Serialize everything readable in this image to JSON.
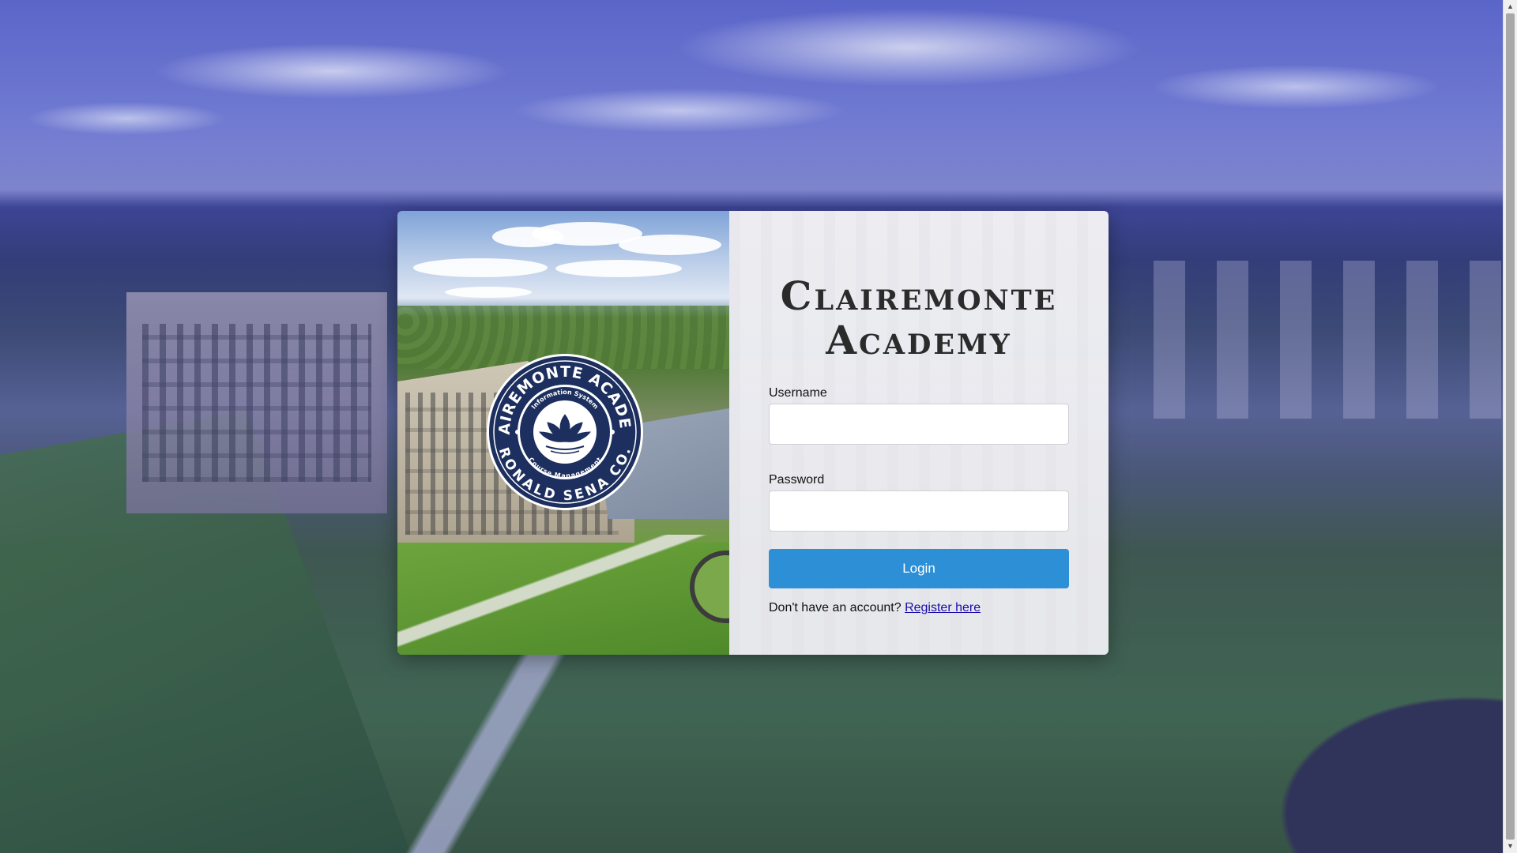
{
  "page": {
    "title_line1": "Clairemonte",
    "title_line2": "Academy"
  },
  "seal": {
    "top_text": "CLAIREMONTE ACADEMY",
    "bottom_text": "RONALD SENA CO.",
    "inner_top_text": "Information System",
    "inner_bottom_text": "Course Management",
    "icon": "lotus-icon"
  },
  "form": {
    "username_label": "Username",
    "username_value": "",
    "password_label": "Password",
    "password_value": "",
    "login_label": "Login",
    "register_prompt": "Don't have an account?",
    "register_link": "Register here"
  },
  "colors": {
    "button": "#2d8fd6",
    "link": "#1a0dab",
    "seal_navy": "#1d2f5e"
  },
  "scrollbar": {
    "up_icon": "chevron-up-icon",
    "down_icon": "chevron-down-icon"
  }
}
